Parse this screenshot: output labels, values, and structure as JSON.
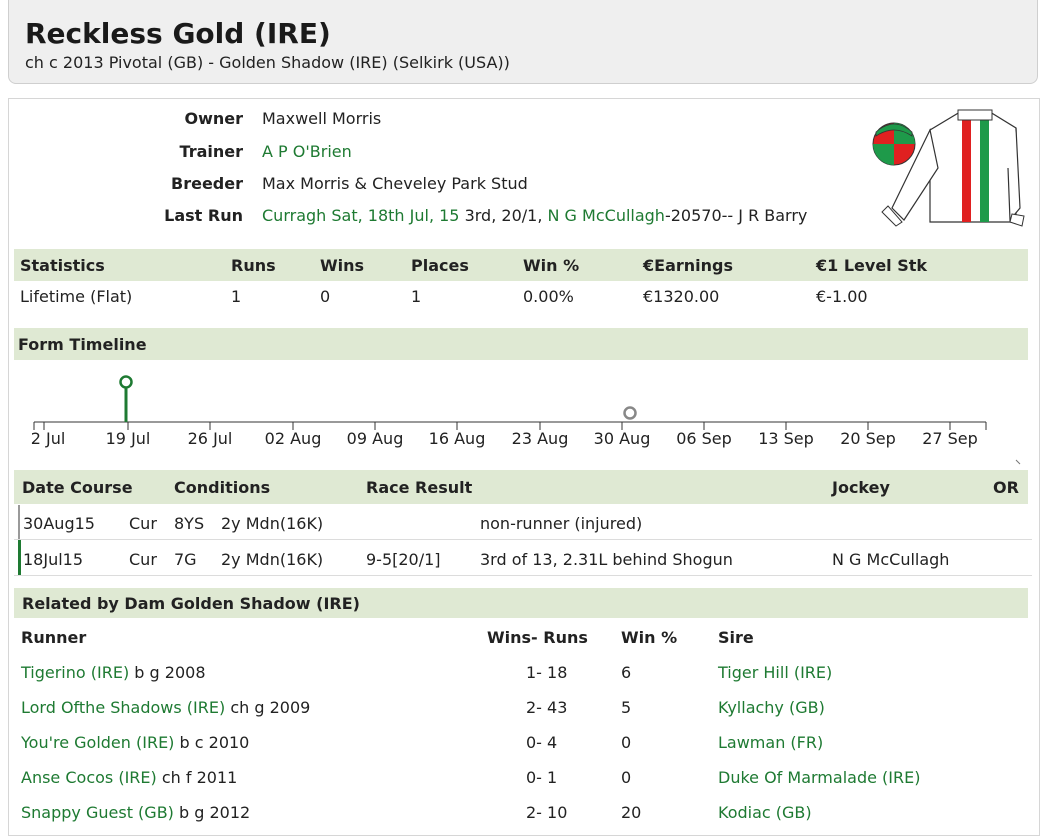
{
  "header": {
    "title": "Reckless Gold (IRE)",
    "subtitle": "ch c 2013 Pivotal (GB) - Golden Shadow (IRE) (Selkirk (USA))"
  },
  "info": {
    "owner_label": "Owner",
    "owner": "Maxwell Morris",
    "trainer_label": "Trainer",
    "trainer": "A P O'Brien",
    "breeder_label": "Breeder",
    "breeder": "Max Morris & Cheveley Park Stud",
    "lastrun_label": "Last Run",
    "lastrun_link": "Curragh Sat, 18th Jul, 15",
    "lastrun_mid": "3rd, 20/1,",
    "lastrun_jockey": "N G McCullagh",
    "lastrun_tail": "-20570-- J R Barry"
  },
  "silks": {
    "colors": [
      "#e02020",
      "#1e9a4a",
      "#ffffff"
    ]
  },
  "stats": {
    "headers": [
      "Statistics",
      "Runs",
      "Wins",
      "Places",
      "Win %",
      "€Earnings",
      "€1 Level Stk"
    ],
    "row": [
      "Lifetime (Flat)",
      "1",
      "0",
      "1",
      "0.00%",
      "€1320.00",
      "€-1.00"
    ]
  },
  "timeline": {
    "title": "Form Timeline",
    "labels": [
      "2 Jul",
      "19 Jul",
      "26 Jul",
      "02 Aug",
      "09 Aug",
      "16 Aug",
      "23 Aug",
      "30 Aug",
      "06 Sep",
      "13 Sep",
      "20 Sep",
      "27 Sep"
    ],
    "colors": {
      "run": "#1e7a32",
      "nonrunner": "#888888"
    }
  },
  "races": {
    "headers": [
      "Date Course",
      "Conditions",
      "Race Result",
      "Jockey",
      "OR"
    ],
    "rows": [
      {
        "date": "30Aug15",
        "course": "Cur",
        "dist": "8YS",
        "cond": "2y Mdn(16K)",
        "weight": "",
        "result": "non-runner (injured)",
        "jockey": "",
        "or": ""
      },
      {
        "date": "18Jul15",
        "course": "Cur",
        "dist": "7G",
        "cond": "2y Mdn(16K)",
        "weight": "9-5[20/1]",
        "result": "3rd of 13, 2.31L behind Shogun",
        "jockey": "N G McCullagh",
        "or": ""
      }
    ]
  },
  "related": {
    "title": "Related by Dam Golden Shadow (IRE)",
    "headers": [
      "Runner",
      "Wins- Runs",
      "Win %",
      "Sire"
    ],
    "rows": [
      {
        "name": "Tigerino (IRE)",
        "desc": "b g 2008",
        "wr": "1- 18",
        "pct": "6",
        "sire": "Tiger Hill (IRE)"
      },
      {
        "name": "Lord Ofthe Shadows (IRE)",
        "desc": "ch g 2009",
        "wr": "2- 43",
        "pct": "5",
        "sire": "Kyllachy (GB)"
      },
      {
        "name": "You're Golden (IRE)",
        "desc": "b c 2010",
        "wr": "0- 4",
        "pct": "0",
        "sire": "Lawman (FR)"
      },
      {
        "name": "Anse Cocos (IRE)",
        "desc": "ch f 2011",
        "wr": "0- 1",
        "pct": "0",
        "sire": "Duke Of Marmalade (IRE)"
      },
      {
        "name": "Snappy Guest (GB)",
        "desc": "b g 2012",
        "wr": "2- 10",
        "pct": "20",
        "sire": "Kodiac (GB)"
      }
    ]
  }
}
